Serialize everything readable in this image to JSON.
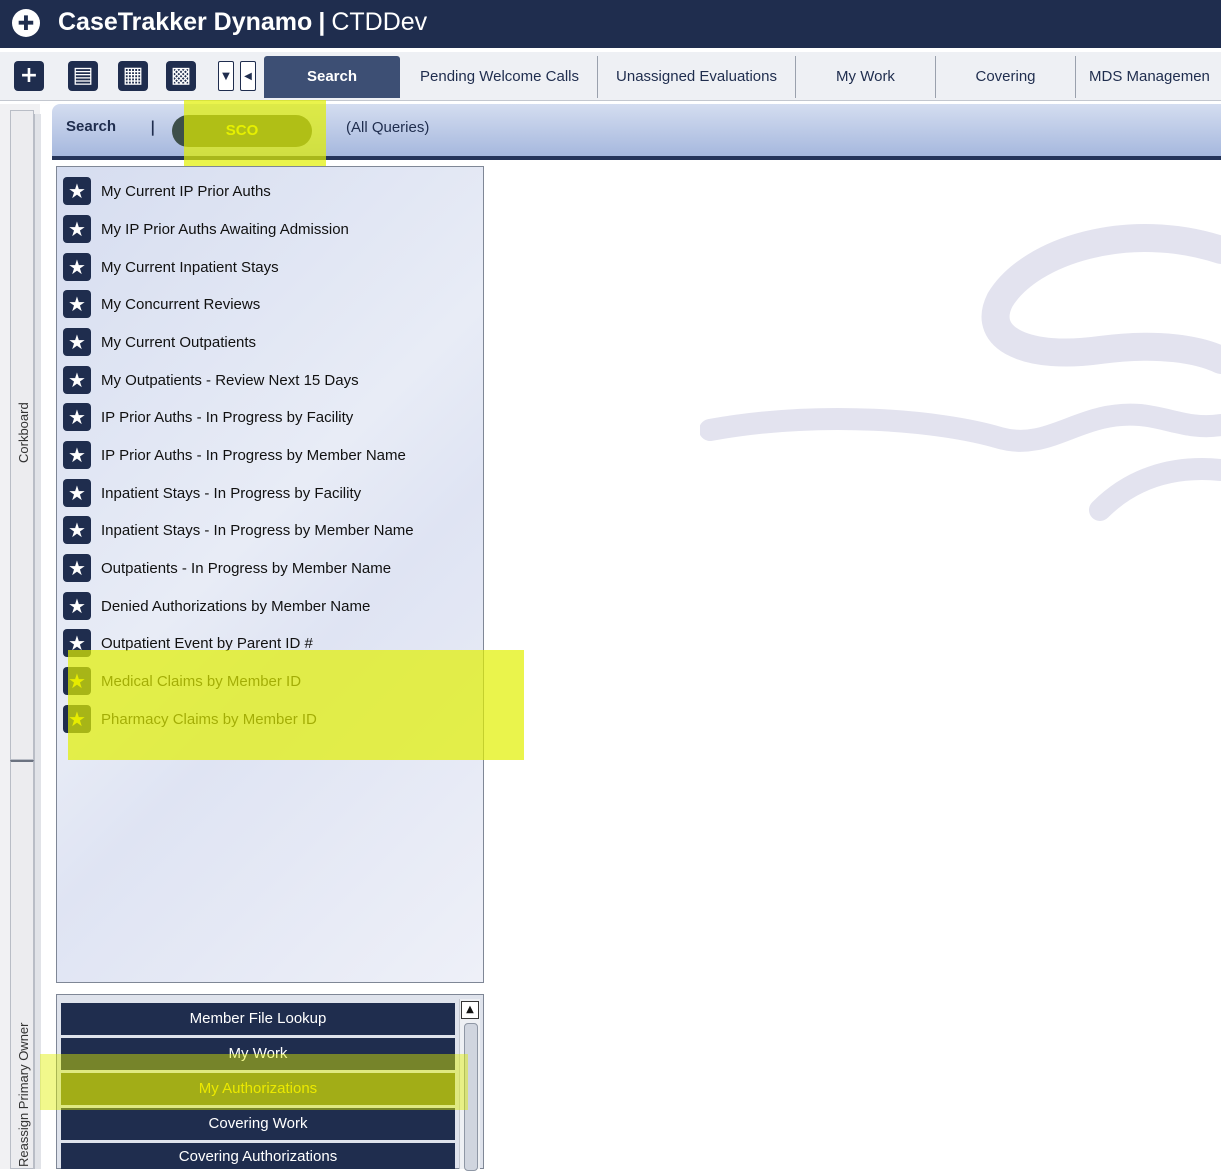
{
  "window": {
    "app_name": "CaseTrakker Dynamo",
    "separator": "|",
    "environment": "CTDDev"
  },
  "toolbar": {
    "icons": [
      "add-icon",
      "book-icon",
      "notepad-icon",
      "chart-icon"
    ],
    "tabs": [
      {
        "label": "Search",
        "active": true
      },
      {
        "label": "Pending Welcome Calls"
      },
      {
        "label": "Unassigned Evaluations"
      },
      {
        "label": "My Work"
      },
      {
        "label": "Covering"
      },
      {
        "label": "MDS Managemen"
      }
    ]
  },
  "side_tabs": {
    "corkboard": "Corkboard",
    "reassign": "Reassign Primary Owner"
  },
  "search_bar": {
    "label": "Search",
    "separator": "|",
    "selected_group": "SCO",
    "scope": "(All Queries)"
  },
  "queries": [
    {
      "label": "My Current IP Prior Auths"
    },
    {
      "label": "My IP Prior Auths Awaiting Admission"
    },
    {
      "label": "My Current Inpatient Stays"
    },
    {
      "label": "My Concurrent Reviews"
    },
    {
      "label": "My Current Outpatients"
    },
    {
      "label": "My Outpatients - Review Next 15 Days"
    },
    {
      "label": "IP Prior Auths - In Progress by Facility"
    },
    {
      "label": "IP Prior Auths - In Progress by Member Name"
    },
    {
      "label": "Inpatient Stays - In Progress by Facility"
    },
    {
      "label": "Inpatient Stays - In Progress by Member Name"
    },
    {
      "label": "Outpatients - In Progress by Member Name"
    },
    {
      "label": "Denied Authorizations by Member Name"
    },
    {
      "label": "Outpatient Event by Parent ID #"
    },
    {
      "label": "Medical Claims by Member ID",
      "favorite": true
    },
    {
      "label": "Pharmacy Claims by Member ID",
      "favorite": true
    }
  ],
  "query_groups": [
    {
      "label": "Member File Lookup"
    },
    {
      "label": "My Work"
    },
    {
      "label": "My Authorizations",
      "selected": true
    },
    {
      "label": "Covering Work"
    },
    {
      "label": "Covering Authorizations"
    }
  ],
  "colors": {
    "navy": "#1f2d4e",
    "highlight": "#e1f000",
    "selected_group": "#70772a"
  }
}
